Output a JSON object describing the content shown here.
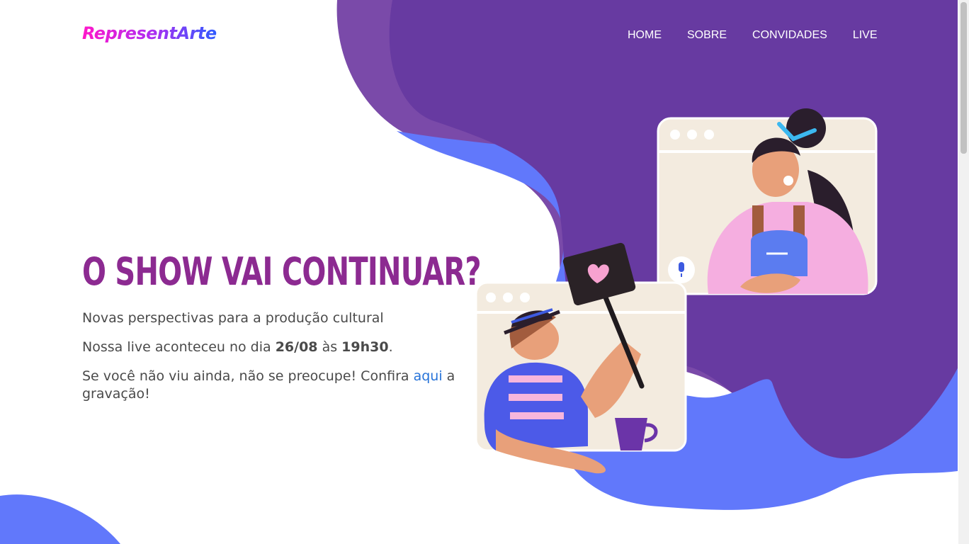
{
  "brand": {
    "logo_text": "RepresentArte"
  },
  "nav": {
    "items": [
      "HOME",
      "SOBRE",
      "CONVIDADES",
      "LIVE"
    ]
  },
  "hero": {
    "title": "O SHOW VAI CONTINUAR?",
    "subtitle": "Novas perspectivas para a produção cultural",
    "live_prefix": "Nossa live aconteceu no dia ",
    "live_date": "26/08",
    "live_mid": " às ",
    "live_time": "19h30",
    "live_suffix": ".",
    "recording_prefix": "Se você não viu ainda, não se preocupe! Confira ",
    "recording_link": "aqui",
    "recording_suffix": " a gravação!"
  },
  "colors": {
    "purple": "#673aa1",
    "blue": "#6178fb",
    "title": "#8c2a91",
    "link": "#2673d9"
  },
  "icons": [
    "heart-sign-icon",
    "microphone-icon",
    "window-dots-icon"
  ]
}
